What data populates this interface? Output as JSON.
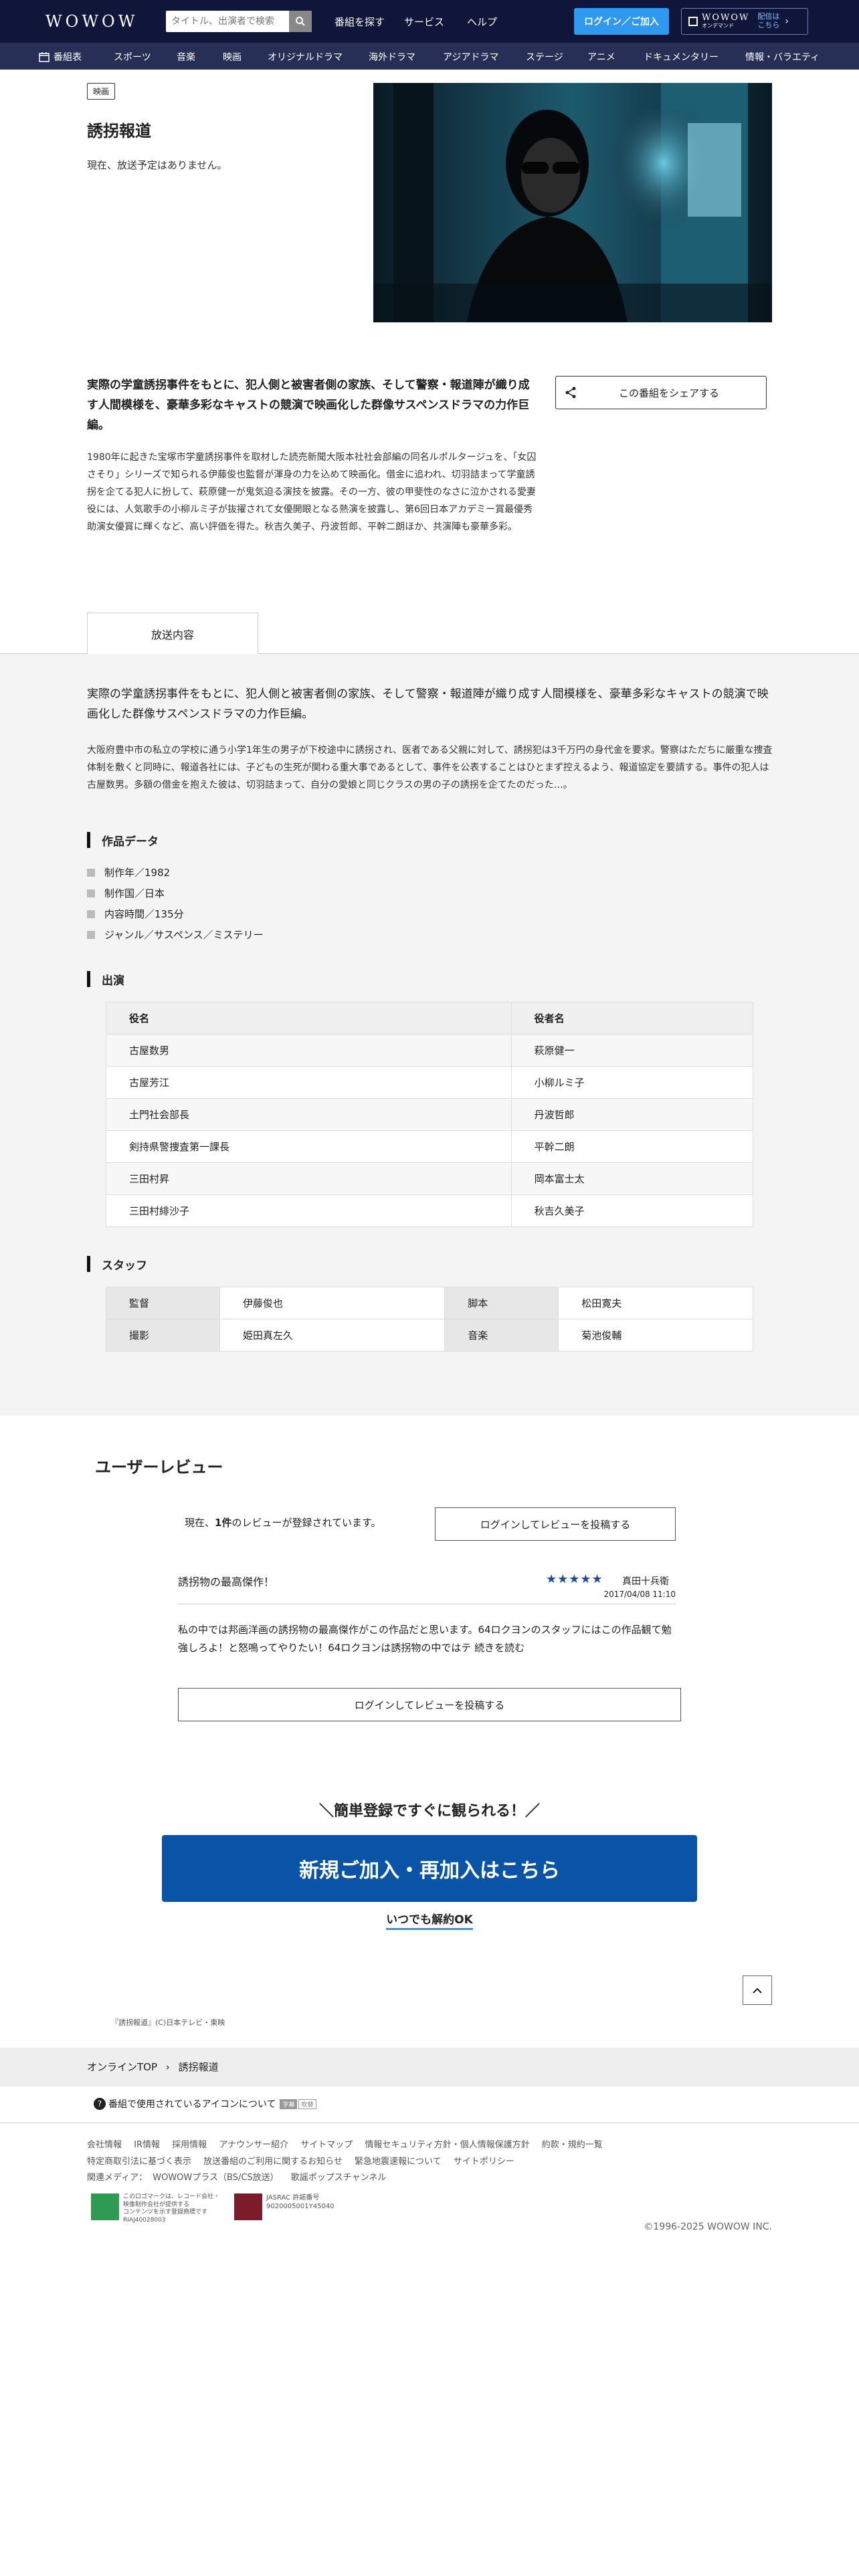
{
  "header": {
    "logo": "WOWOW",
    "search_placeholder": "タイトル、出演者で検索",
    "nav": [
      "番組を探す",
      "サービス",
      "ヘルプ"
    ],
    "login_label": "ログイン／ご加入",
    "ondemand_brand": "WOWOW",
    "ondemand_sub": "オンデマンド",
    "ondemand_label": "配信は\nこちら"
  },
  "genres": [
    "番組表",
    "スポーツ",
    "音楽",
    "映画",
    "オリジナルドラマ",
    "海外ドラマ",
    "アジアドラマ",
    "ステージ",
    "アニメ",
    "ドキュメンタリー",
    "情報・バラエティ"
  ],
  "program": {
    "badge": "映画",
    "title": "誘拐報道",
    "schedule": "現在、放送予定はありません。",
    "lead": "実際の学童誘拐事件をもとに、犯人側と被害者側の家族、そして警察・報道陣が織り成す人間模様を、豪華多彩なキャストの競演で映画化した群像サスペンスドラマの力作巨編。",
    "description": "1980年に起きた宝塚市学童誘拐事件を取材した読売新聞大阪本社社会部編の同名ルポルタージュを、「女囚さそり」シリーズで知られる伊藤俊也監督が渾身の力を込めて映画化。借金に追われ、切羽詰まって学童誘拐を企てる犯人に扮して、萩原健一が鬼気迫る演技を披露。その一方、彼の甲斐性のなさに泣かされる愛妻役には、人気歌手の小柳ルミ子が抜擢されて女優開眼となる熱演を披露し、第6回日本アカデミー賞最優秀助演女優賞に輝くなど、高い評価を得た。秋吉久美子、丹波哲郎、平幹二朗ほか、共演陣も豪華多彩。",
    "share_label": "この番組をシェアする"
  },
  "broadcast": {
    "tab_label": "放送内容",
    "lead": "実際の学童誘拐事件をもとに、犯人側と被害者側の家族、そして警察・報道陣が織り成す人間模様を、豪華多彩なキャストの競演で映画化した群像サスペンスドラマの力作巨編。",
    "story": "大阪府豊中市の私立の学校に通う小学1年生の男子が下校途中に誘拐され、医者である父親に対して、誘拐犯は3千万円の身代金を要求。警察はただちに厳重な捜査体制を敷くと同時に、報道各社には、子どもの生死が関わる重大事であるとして、事件を公表することはひとまず控えるよう、報道協定を要請する。事件の犯人は古屋数男。多額の借金を抱えた彼は、切羽詰まって、自分の愛娘と同じクラスの男の子の誘拐を企てたのだった…。",
    "spec_title": "作品データ",
    "specs": [
      "制作年／1982",
      "制作国／日本",
      "内容時間／135分",
      "ジャンル／サスペンス／ミステリー"
    ],
    "cast_title": "出演",
    "cast_headers": [
      "役名",
      "役者名"
    ],
    "cast": [
      [
        "古屋数男",
        "萩原健一"
      ],
      [
        "古屋芳江",
        "小柳ルミ子"
      ],
      [
        "土門社会部長",
        "丹波哲郎"
      ],
      [
        "剣持県警捜査第一課長",
        "平幹二朗"
      ],
      [
        "三田村昇",
        "岡本富士太"
      ],
      [
        "三田村緋沙子",
        "秋吉久美子"
      ]
    ],
    "staff_title": "スタッフ",
    "staff": [
      [
        "監督",
        "伊藤俊也",
        "脚本",
        "松田寛夫"
      ],
      [
        "撮影",
        "姫田真左久",
        "音楽",
        "菊池俊輔"
      ]
    ]
  },
  "reviews": {
    "title": "ユーザーレビュー",
    "count_prefix": "現在、",
    "count_value": "1件",
    "count_suffix": "のレビューが登録されています。",
    "post_label": "ログインしてレビューを投稿する",
    "item": {
      "headline": "誘拐物の最高傑作！",
      "stars": "★★★★★",
      "reviewer": "真田十兵衛",
      "date": "2017/04/08 11:10",
      "body": "私の中では邦画洋画の誘拐物の最高傑作がこの作品だと思います。64ロクヨンのスタッフにはこの作品観て勉強しろよ！と怒鳴ってやりたい！64ロクヨンは誘拐物の中ではテ 続きを読む"
    }
  },
  "cta": {
    "catch": "＼簡単登録ですぐに観られる！／",
    "button": "新規ご加入・再加入はこちら",
    "sub": "いつでも解約OK"
  },
  "footer": {
    "image_copyright": "『誘拐報道』(C)日本テレビ・東映",
    "breadcrumb_home": "オンラインTOP",
    "breadcrumb_current": "誘拐報道",
    "icon_note": "番組で使用されているアイコンについて",
    "icon_badges": [
      "字幕",
      "吹替"
    ],
    "links": [
      "会社情報",
      "IR情報",
      "採用情報",
      "アナウンサー紹介",
      "サイトマップ",
      "情報セキュリティ方針・個人情報保護方針",
      "約款・規約一覧",
      "特定商取引法に基づく表示",
      "放送番組のご利用に関するお知らせ",
      "緊急地震速報について",
      "サイトポリシー"
    ],
    "media_label": "関連メディア：",
    "media_links": [
      "WOWOWプラス（BS/CS放送）",
      "歌謡ポップスチャンネル"
    ],
    "mark1": "このロゴマークは、レコード会社・映像制作会社が提供する\nコンテンツを示す登録商標です\nRIAJ40028003",
    "mark2": "JASRAC 許諾番号\n9020005001Y45040",
    "copyright": "©1996-2025 WOWOW INC."
  },
  "colors": {
    "header_bg": "#10163a",
    "genre_bg": "#282f56",
    "accent": "#2e99ef",
    "cta": "#0954a6",
    "stars": "#1f4aa0"
  }
}
